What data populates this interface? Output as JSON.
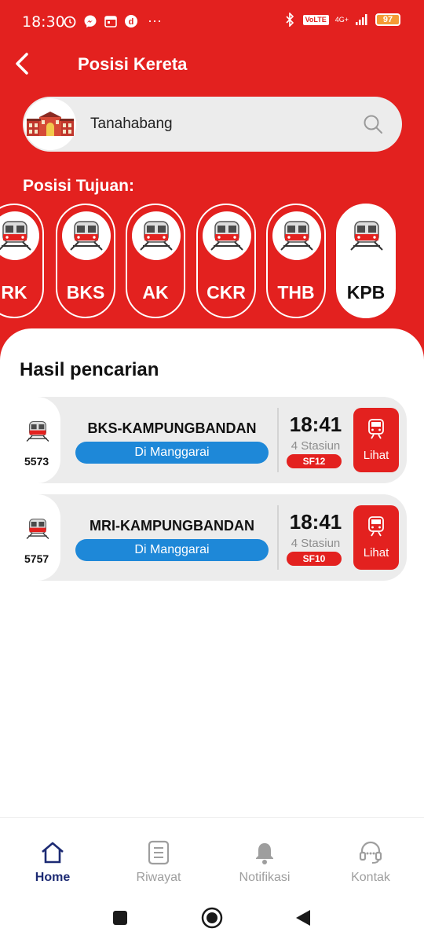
{
  "status_bar": {
    "time": "18:30",
    "more": "···",
    "network": "4G+",
    "volte": "VoLTE",
    "battery": "97"
  },
  "header": {
    "title": "Posisi Kereta"
  },
  "search": {
    "station": "Tanahabang"
  },
  "destinations": {
    "label": "Posisi Tujuan:",
    "items": [
      {
        "code": "RK",
        "active": false
      },
      {
        "code": "BKS",
        "active": false
      },
      {
        "code": "AK",
        "active": false
      },
      {
        "code": "CKR",
        "active": false
      },
      {
        "code": "THB",
        "active": false
      },
      {
        "code": "KPB",
        "active": true
      }
    ]
  },
  "results": {
    "title": "Hasil pencarian",
    "items": [
      {
        "train_no": "5573",
        "route": "BKS-KAMPUNGBANDAN",
        "location": "Di Manggarai",
        "time": "18:41",
        "stations": "4 Stasiun",
        "platform": "SF12",
        "action": "Lihat"
      },
      {
        "train_no": "5757",
        "route": "MRI-KAMPUNGBANDAN",
        "location": "Di Manggarai",
        "time": "18:41",
        "stations": "4 Stasiun",
        "platform": "SF10",
        "action": "Lihat"
      }
    ]
  },
  "bottom_nav": {
    "items": [
      {
        "label": "Home",
        "icon": "home-icon",
        "active": true
      },
      {
        "label": "Riwayat",
        "icon": "history-icon",
        "active": false
      },
      {
        "label": "Notifikasi",
        "icon": "bell-icon",
        "active": false
      },
      {
        "label": "Kontak",
        "icon": "headset-icon",
        "active": false
      }
    ]
  },
  "colors": {
    "primary": "#e3211f",
    "accent_blue": "#1e88d8",
    "nav_active": "#1c2a73"
  }
}
